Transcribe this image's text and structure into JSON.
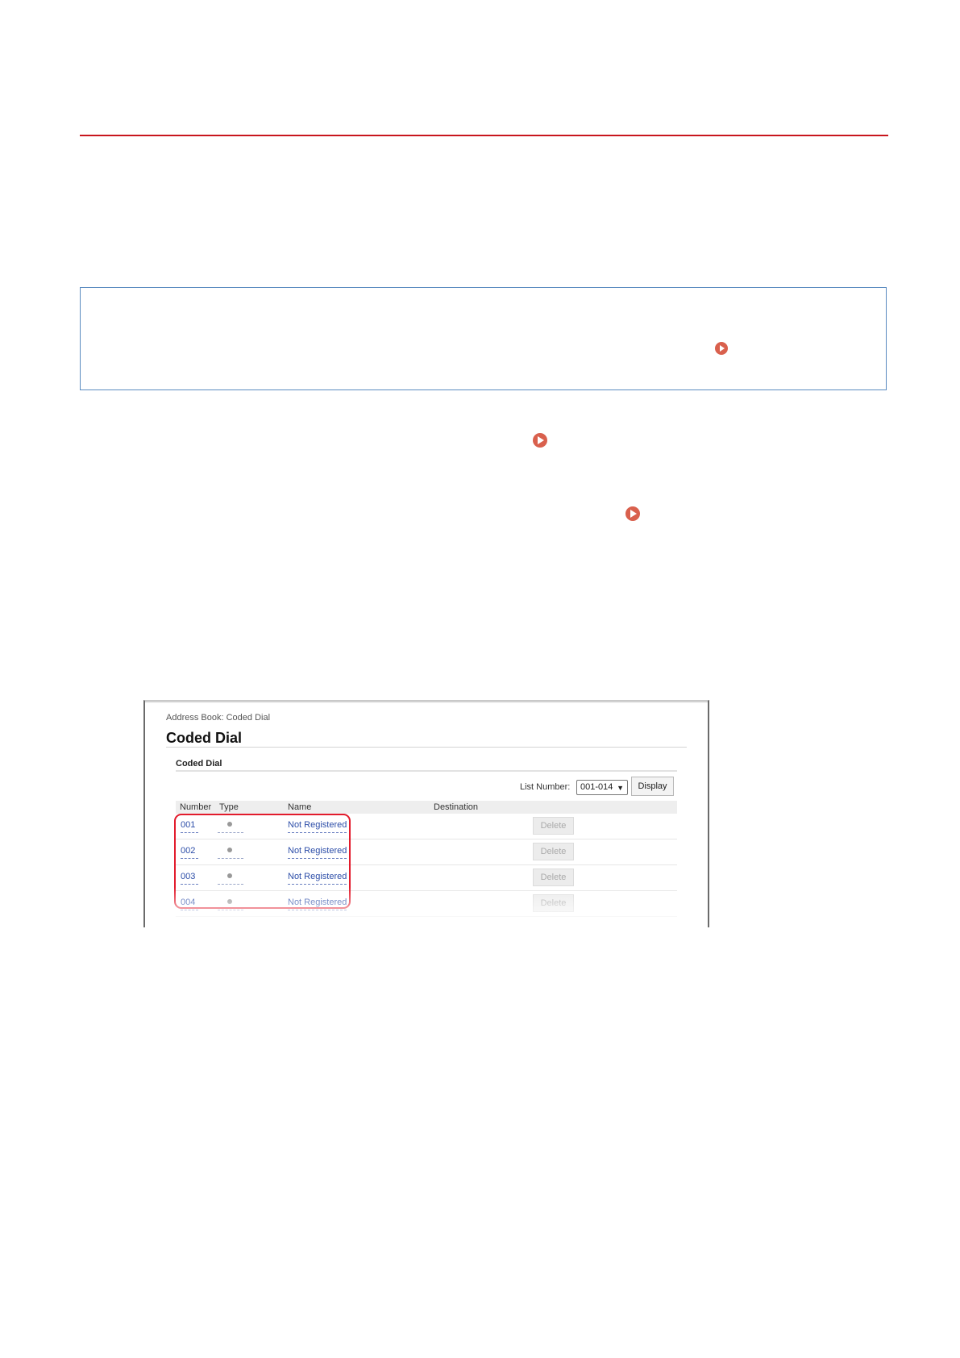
{
  "screenshot": {
    "breadcrumb": "Address Book: Coded Dial",
    "title": "Coded Dial",
    "section_title": "Coded Dial",
    "list_number_label": "List Number:",
    "list_number_value": "001-014",
    "display_button": "Display",
    "columns": [
      "Number",
      "Type",
      "Name",
      "Destination"
    ],
    "rows": [
      {
        "number": "001",
        "name": "Not Registered",
        "delete": "Delete"
      },
      {
        "number": "002",
        "name": "Not Registered",
        "delete": "Delete"
      },
      {
        "number": "003",
        "name": "Not Registered",
        "delete": "Delete"
      },
      {
        "number": "004",
        "name": "Not Registered",
        "delete": "Delete"
      }
    ]
  },
  "colors": {
    "heading_rule": "#c8161d",
    "info_border": "#5a8bc0",
    "link_arrow": "#d9604d",
    "highlight": "#e21b2c"
  }
}
